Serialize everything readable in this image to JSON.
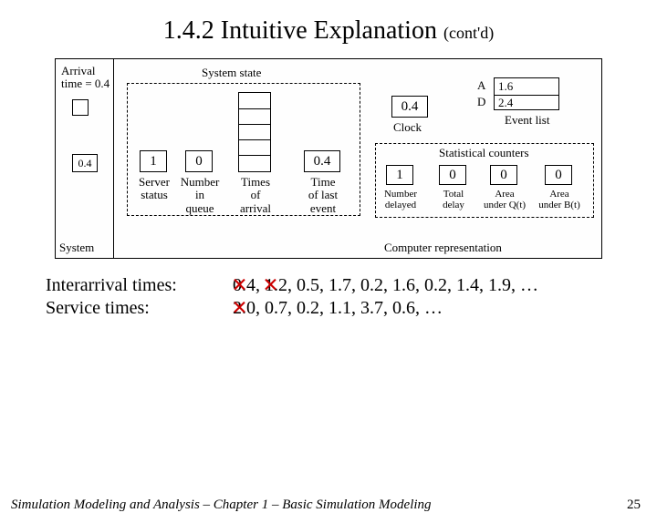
{
  "title": {
    "main": "1.4.2  Intuitive Explanation",
    "contd": "(cont'd)"
  },
  "diagram": {
    "arrival_time_label": "Arrival\ntime = 0.4",
    "system_label": "System",
    "system_state_label": "System state",
    "server_status": {
      "label": "Server\nstatus",
      "value": "1"
    },
    "number_in_queue": {
      "label": "Number\nin\nqueue",
      "value": "0"
    },
    "times_of_arrival_label": "Times\nof\narrival",
    "time_last_event": {
      "label": "Time\nof last\nevent",
      "value": "0.4"
    },
    "computer_rep_label": "Computer representation",
    "clock": {
      "label": "Clock",
      "value": "0.4"
    },
    "event_list": {
      "label": "Event list",
      "A": "A",
      "Aval": "1.6",
      "D": "D",
      "Dval": "2.4"
    },
    "stat_counters_label": "Statistical counters",
    "counters": {
      "num_delayed": {
        "label": "Number\ndelayed",
        "value": "1"
      },
      "total_delay": {
        "label": "Total\ndelay",
        "value": "0"
      },
      "area_q": {
        "label": "Area\nunder Q(t)",
        "value": "0"
      },
      "area_b": {
        "label": "Area\nunder B(t)",
        "value": "0"
      }
    },
    "arrival_token": "0.4"
  },
  "lists": {
    "interarrival_label": "Interarrival times:",
    "interarrival_values": "   0.4, 1.2, 0.5, 1.7, 0.2, 1.6, 0.2, 1.4, 1.9, …",
    "service_label": "Service times:",
    "service_values": "   2.0, 0.7, 0.2, 1.1, 3.7, 0.6, …"
  },
  "footer": {
    "left": "Simulation Modeling and Analysis – Chapter 1 –  Basic Simulation Modeling",
    "page": "25"
  }
}
